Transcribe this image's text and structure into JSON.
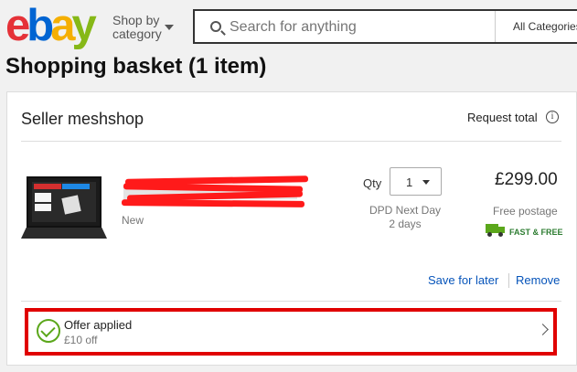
{
  "header": {
    "logo_letters": [
      "e",
      "b",
      "a",
      "y"
    ],
    "shop_by_line1": "Shop by",
    "shop_by_line2": "category",
    "search_placeholder": "Search for anything",
    "category_select": "All Categories"
  },
  "page": {
    "title": "Shopping basket (1 item)"
  },
  "seller": {
    "name": "Seller meshshop",
    "request_total": "Request total",
    "info_icon": "info-icon"
  },
  "item": {
    "title_redacted": true,
    "condition": "New",
    "qty_label": "Qty",
    "qty_value": "1",
    "delivery_line1": "DPD Next Day",
    "delivery_line2": "2 days",
    "price": "£299.00",
    "postage": "Free postage",
    "badge": "FAST & FREE",
    "save_for_later": "Save for later",
    "remove": "Remove"
  },
  "offer": {
    "title": "Offer applied",
    "subtitle": "£10 off",
    "highlight_color": "#e00000"
  },
  "colors": {
    "ebay_red": "#e53238",
    "ebay_blue": "#0064d2",
    "ebay_yellow": "#f5af02",
    "ebay_green": "#86b817",
    "link": "#0654ba",
    "success_green": "#5ba71b"
  }
}
